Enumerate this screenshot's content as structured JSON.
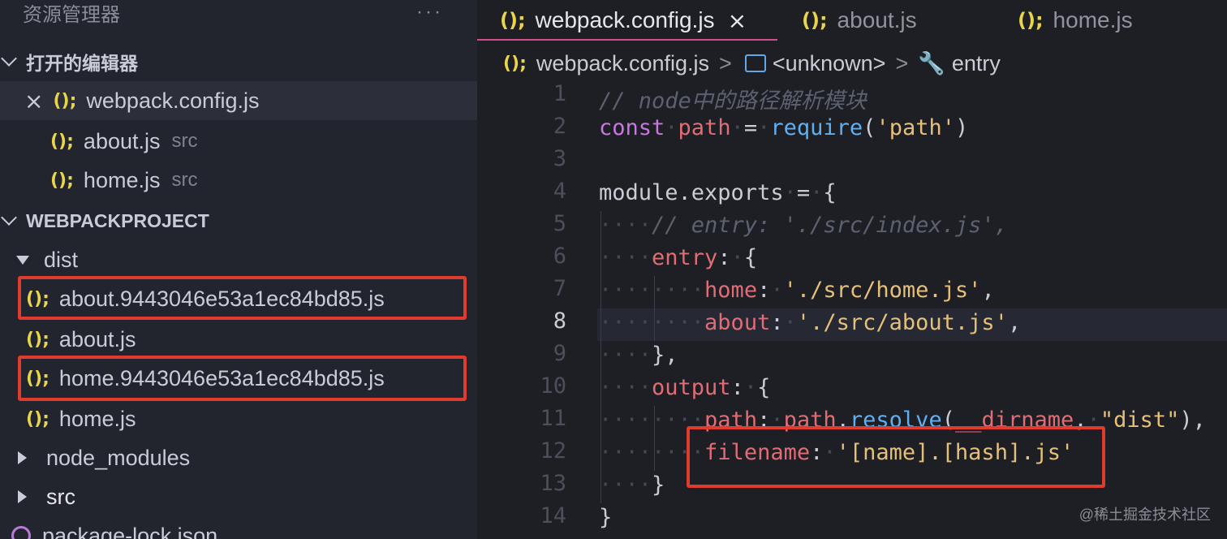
{
  "sidebar": {
    "title": "资源管理器",
    "more": "···",
    "open_editors": {
      "label": "打开的编辑器",
      "items": [
        {
          "icon": "();",
          "name": "webpack.config.js",
          "desc": ""
        },
        {
          "icon": "();",
          "name": "about.js",
          "desc": "src"
        },
        {
          "icon": "();",
          "name": "home.js",
          "desc": "src"
        }
      ]
    },
    "project": {
      "label": "WEBPACKPROJECT",
      "tree": [
        {
          "name": "dist"
        },
        {
          "icon": "();",
          "name": "about.9443046e53a1ec84bd85.js"
        },
        {
          "icon": "();",
          "name": "about.js"
        },
        {
          "icon": "();",
          "name": "home.9443046e53a1ec84bd85.js"
        },
        {
          "icon": "();",
          "name": "home.js"
        },
        {
          "name": "node_modules"
        },
        {
          "name": "src"
        },
        {
          "name": "package-lock.json"
        }
      ]
    }
  },
  "tabs": [
    {
      "icon": "();",
      "label": "webpack.config.js",
      "close": "×"
    },
    {
      "icon": "();",
      "label": "about.js"
    },
    {
      "icon": "();",
      "label": "home.js"
    }
  ],
  "breadcrumb": {
    "file_icon": "();",
    "file": "webpack.config.js",
    "symbol": "<unknown>",
    "item": "entry",
    "sep": ">"
  },
  "editor": {
    "current_line": 8,
    "line_numbers": [
      "1",
      "2",
      "3",
      "4",
      "5",
      "6",
      "7",
      "8",
      "9",
      "10",
      "11",
      "12",
      "13",
      "14"
    ]
  },
  "watermark": "@稀土掘金技术社区",
  "colors": {
    "highlight_box": "#e03b2f",
    "js_icon": "#e8d44d",
    "tab_underline": "#d14d8e"
  }
}
